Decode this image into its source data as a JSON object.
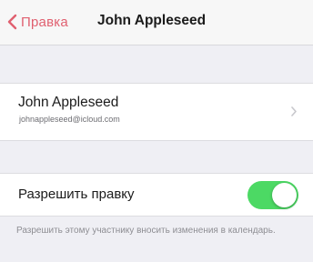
{
  "navbar": {
    "back_label": "Правка",
    "title": "John Appleseed",
    "back_icon": "chevron-left-icon"
  },
  "account": {
    "name": "John Appleseed",
    "email": "johnappleseed@icloud.com",
    "disclosure_icon": "chevron-right-icon"
  },
  "permission": {
    "label": "Разрешить правку",
    "enabled": true,
    "footer": "Разрешить этому участнику вносить изменения в календарь."
  },
  "colors": {
    "accent": "#e06070",
    "switch_on": "#4cd964",
    "background": "#efeff4"
  }
}
